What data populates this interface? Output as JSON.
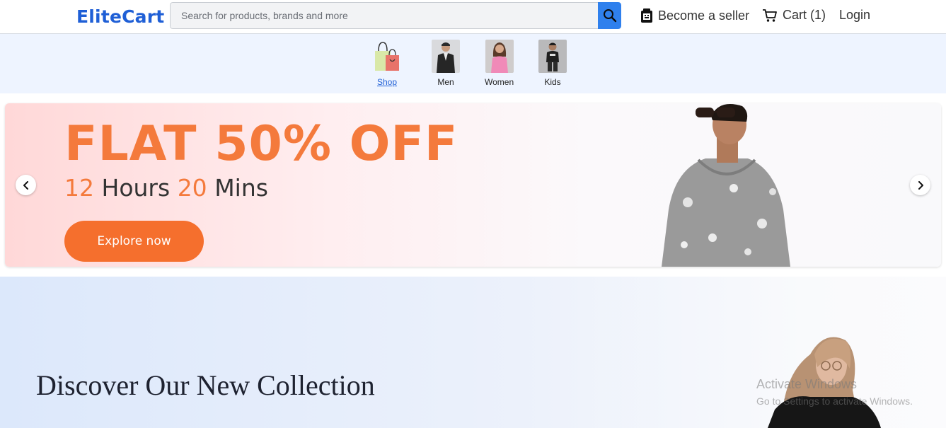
{
  "header": {
    "logo": "EliteCart",
    "search_placeholder": "Search for products, brands and more",
    "search_value": "",
    "become_seller": "Become a seller",
    "cart": "Cart (1)",
    "login": "Login"
  },
  "categories": [
    {
      "label": "Shop",
      "active": true
    },
    {
      "label": "Men",
      "active": false
    },
    {
      "label": "Women",
      "active": false
    },
    {
      "label": "Kids",
      "active": false
    }
  ],
  "hero": {
    "headline": "FLAT 50% OFF",
    "hours_value": "12",
    "hours_label": "Hours",
    "mins_value": "20",
    "mins_label": "Mins",
    "cta": "Explore now",
    "prev_icon": "chevron-left-icon",
    "next_icon": "chevron-right-icon"
  },
  "collection": {
    "title": "Discover Our New Collection"
  },
  "watermark": {
    "line1": "Activate Windows",
    "line2": "Go to Settings to activate Windows."
  },
  "colors": {
    "brand": "#1f5fd6",
    "search_button": "#2f80ed",
    "accent_orange": "#f47a3c",
    "cta_orange": "#f56f2d",
    "category_strip": "#eef4ff"
  }
}
